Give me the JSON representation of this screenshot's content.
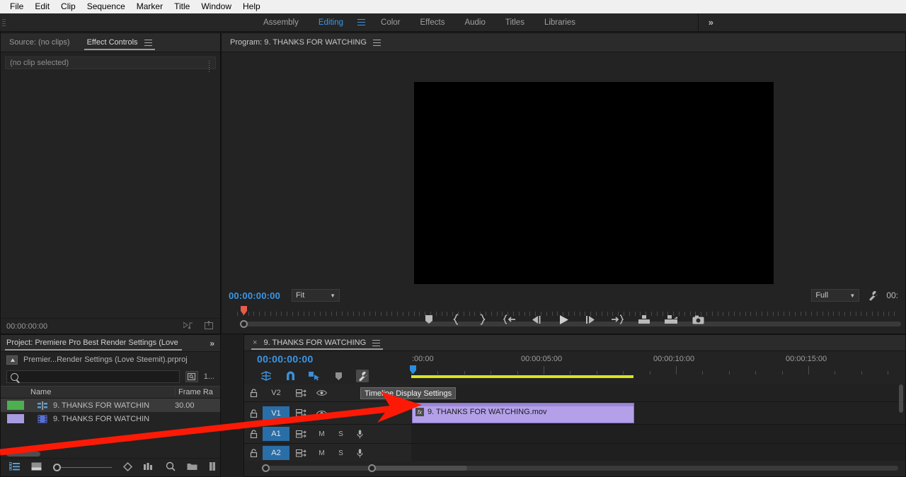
{
  "menubar": {
    "items": [
      "File",
      "Edit",
      "Clip",
      "Sequence",
      "Marker",
      "Title",
      "Window",
      "Help"
    ]
  },
  "workspace": {
    "items": [
      {
        "label": "Assembly",
        "active": false
      },
      {
        "label": "Editing",
        "active": true
      },
      {
        "label": "Color",
        "active": false
      },
      {
        "label": "Effects",
        "active": false
      },
      {
        "label": "Audio",
        "active": false
      },
      {
        "label": "Titles",
        "active": false
      },
      {
        "label": "Libraries",
        "active": false
      }
    ],
    "overflow_label": "»",
    "active_color": "#3a97e8"
  },
  "effect_controls": {
    "tabs": [
      {
        "label": "Source: (no clips)",
        "active": false
      },
      {
        "label": "Effect Controls",
        "active": true
      }
    ],
    "empty_message": "(no clip selected)",
    "footer_timecode": "00:00:00:00"
  },
  "program_monitor": {
    "tab_label": "Program: 9. THANKS FOR WATCHING",
    "timecode": "00:00:00:00",
    "fit_label": "Fit",
    "quality_label": "Full",
    "right_timecode": "00:",
    "timecode_color": "#3a97e8",
    "transport_buttons": [
      "add-marker",
      "mark-in",
      "mark-out",
      "go-to-in",
      "step-back",
      "play-stop",
      "step-forward",
      "go-to-out",
      "lift",
      "extract",
      "export-frame"
    ]
  },
  "project": {
    "tab_label": "Project: Premiere Pro Best Render Settings (Love",
    "overflow_label": "»",
    "breadcrumb": "Premier...Render Settings (Love Steemit).prproj",
    "search_placeholder": "",
    "search_value": "",
    "item_count": "1...",
    "columns": [
      "Name",
      "Frame Rа"
    ],
    "rows": [
      {
        "name": "9. THANKS FOR WATCHIN",
        "frame_rate": "30.00",
        "swatch": "#4caf50",
        "kind": "sequence",
        "selected": true
      },
      {
        "name": "9. THANKS FOR WATCHIN",
        "frame_rate": "",
        "swatch": "#a89be0",
        "kind": "clip",
        "selected": false
      }
    ],
    "footer_icons": [
      "list-view-icon",
      "icon-view-icon",
      "zoom-slider",
      "sort-icon",
      "freeform-icon",
      "find-icon",
      "new-bin-icon",
      "new-item-icon"
    ]
  },
  "tools": {
    "items": [
      {
        "name": "selection-tool",
        "active": true
      },
      {
        "name": "track-select-forward-tool",
        "active": false
      },
      {
        "name": "track-select-backward-tool",
        "active": false
      },
      {
        "name": "ripple-edit-tool",
        "active": false
      },
      {
        "name": "rolling-edit-tool",
        "active": false
      },
      {
        "name": "rate-stretch-tool",
        "active": false
      },
      {
        "name": "razor-tool",
        "active": false
      },
      {
        "name": "slip-tool",
        "active": false
      }
    ]
  },
  "timeline": {
    "tab_label": "9. THANKS FOR WATCHING",
    "close_label": "×",
    "timecode": "00:00:00:00",
    "timecode_color": "#3a97e8",
    "toolbar_icons": [
      "insert-overwrite-icon",
      "snap-icon",
      "linked-selection-icon",
      "add-marker-icon",
      "timeline-display-settings-icon"
    ],
    "ruler_labels": [
      ":00:00",
      "00:00:05:00",
      "00:00:10:00",
      "00:00:15:00"
    ],
    "render_bar_color": "#dbe41f",
    "tracks": [
      {
        "name": "V2",
        "type": "video",
        "enabled": false,
        "lock": false,
        "sync": true,
        "eye": true
      },
      {
        "name": "V1",
        "type": "video",
        "enabled": true,
        "lock": false,
        "sync": true,
        "eye": true
      },
      {
        "name": "A1",
        "type": "audio",
        "enabled": true,
        "lock": false,
        "sync": true,
        "mute": "M",
        "solo": "S"
      },
      {
        "name": "A2",
        "type": "audio",
        "enabled": true,
        "lock": false,
        "sync": true,
        "mute": "M",
        "solo": "S"
      }
    ],
    "clip": {
      "label": "9. THANKS FOR WATCHING.mov",
      "fx_badge": "fx",
      "color": "#b3a0e8"
    }
  },
  "tooltip": {
    "text": "Timeline Display Settings"
  }
}
